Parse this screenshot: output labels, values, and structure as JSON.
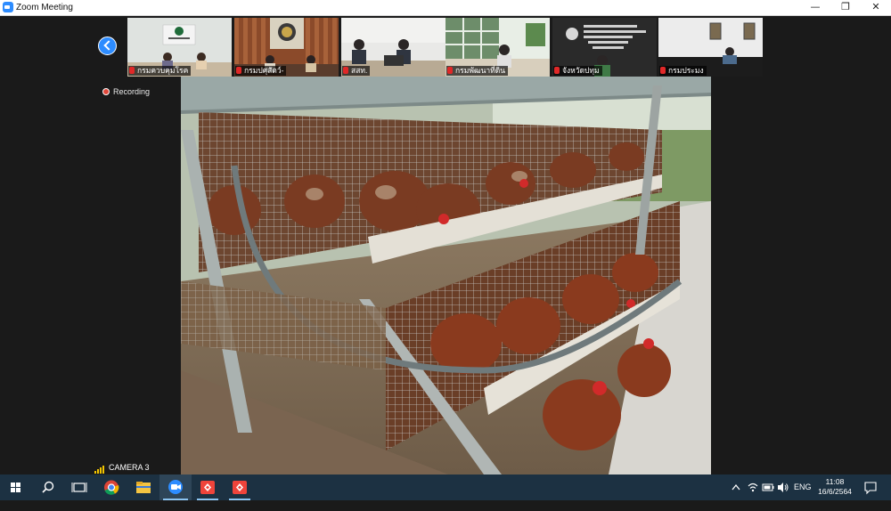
{
  "window": {
    "title": "Zoom Meeting",
    "minimize_label": "—",
    "restore_label": "❐",
    "close_label": "✕"
  },
  "participants": [
    {
      "name": "กรมควบคุมโรค",
      "muted": true
    },
    {
      "name": "กรมปศุสัตว์-",
      "muted": true
    },
    {
      "name": "สสท.",
      "muted": true
    },
    {
      "name": "กรมพัฒนาที่ดิน",
      "muted": true
    },
    {
      "name": "จังหวัดปทุม",
      "muted": true
    },
    {
      "name": "กรมประมง",
      "muted": true
    }
  ],
  "meeting": {
    "recording_label": "Recording",
    "active_speaker_label": "CAMERA 3"
  },
  "taskbar": {
    "pinned": [
      "windows-start",
      "search",
      "task-view",
      "chrome",
      "file-explorer",
      "zoom",
      "anydesk",
      "anydesk"
    ],
    "tray": {
      "language": "ENG",
      "time": "11:08",
      "date": "16/6/2564"
    }
  },
  "colors": {
    "zoom_blue": "#2d8cff",
    "meeting_bg": "#1a1a1a",
    "taskbar_bg": "#1c3142",
    "recording_red": "#e0483b",
    "muted_red": "#e02828"
  }
}
